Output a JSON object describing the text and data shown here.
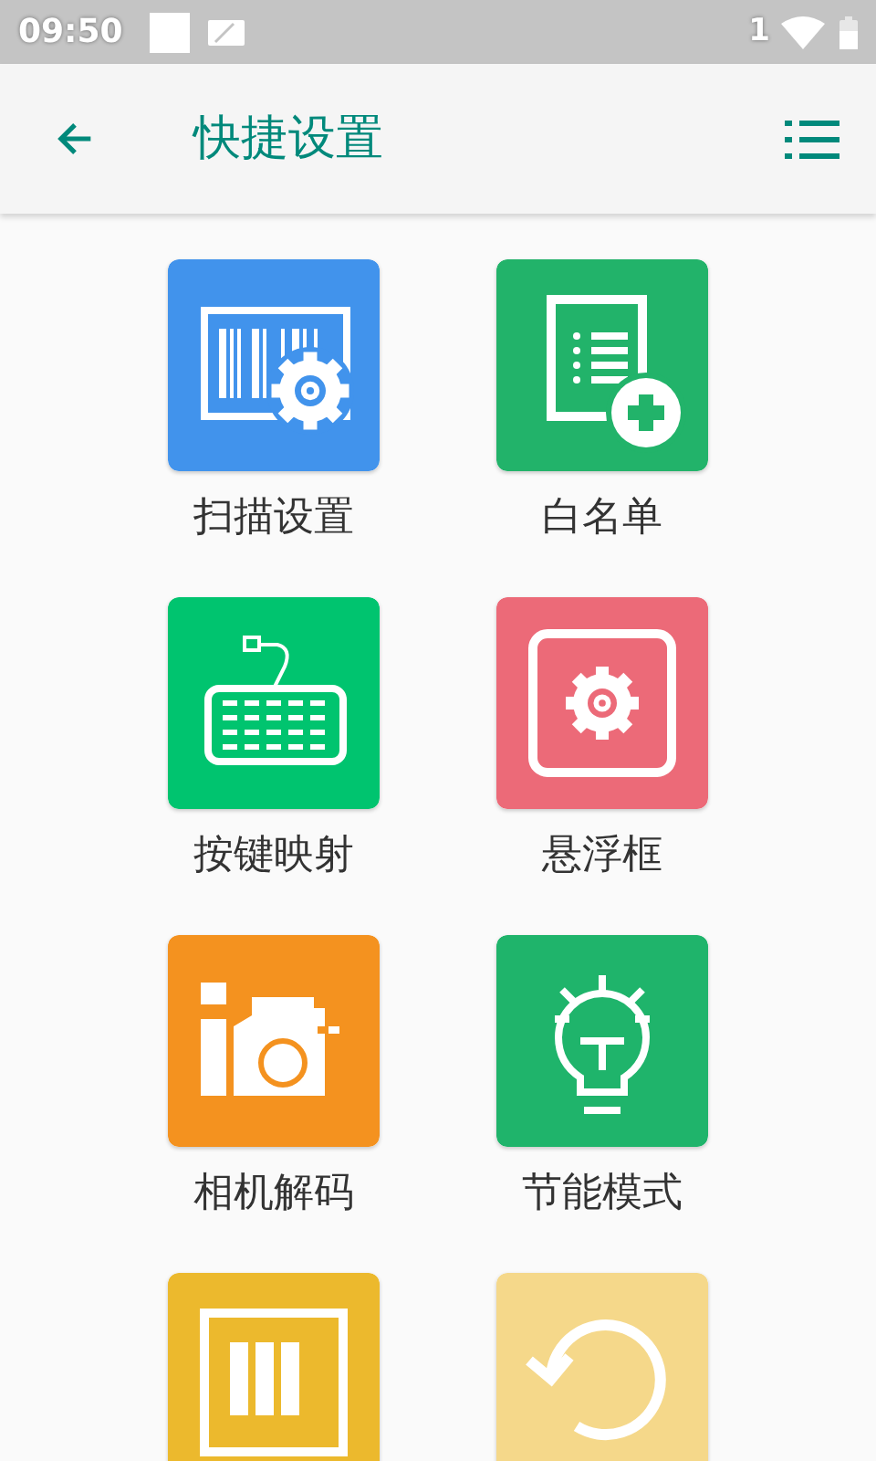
{
  "status_bar": {
    "time": "09:50",
    "sim": "1"
  },
  "app_bar": {
    "title": "快捷设置"
  },
  "items": [
    {
      "kind": "barcode",
      "label": "扫描设置",
      "color": "#4193ec"
    },
    {
      "kind": "whitelist",
      "label": "白名单",
      "color": "#22b36a"
    },
    {
      "kind": "keyboard",
      "label": "按键映射",
      "color": "#00c46f"
    },
    {
      "kind": "float",
      "label": "悬浮框",
      "color": "#ec6a78"
    },
    {
      "kind": "camera",
      "label": "相机解码",
      "color": "#f4921f"
    },
    {
      "kind": "bulb",
      "label": "节能模式",
      "color": "#1fb46b"
    },
    {
      "kind": "panel",
      "color": "#ecb92d"
    },
    {
      "kind": "refresh",
      "color": "#f5d88a"
    }
  ]
}
